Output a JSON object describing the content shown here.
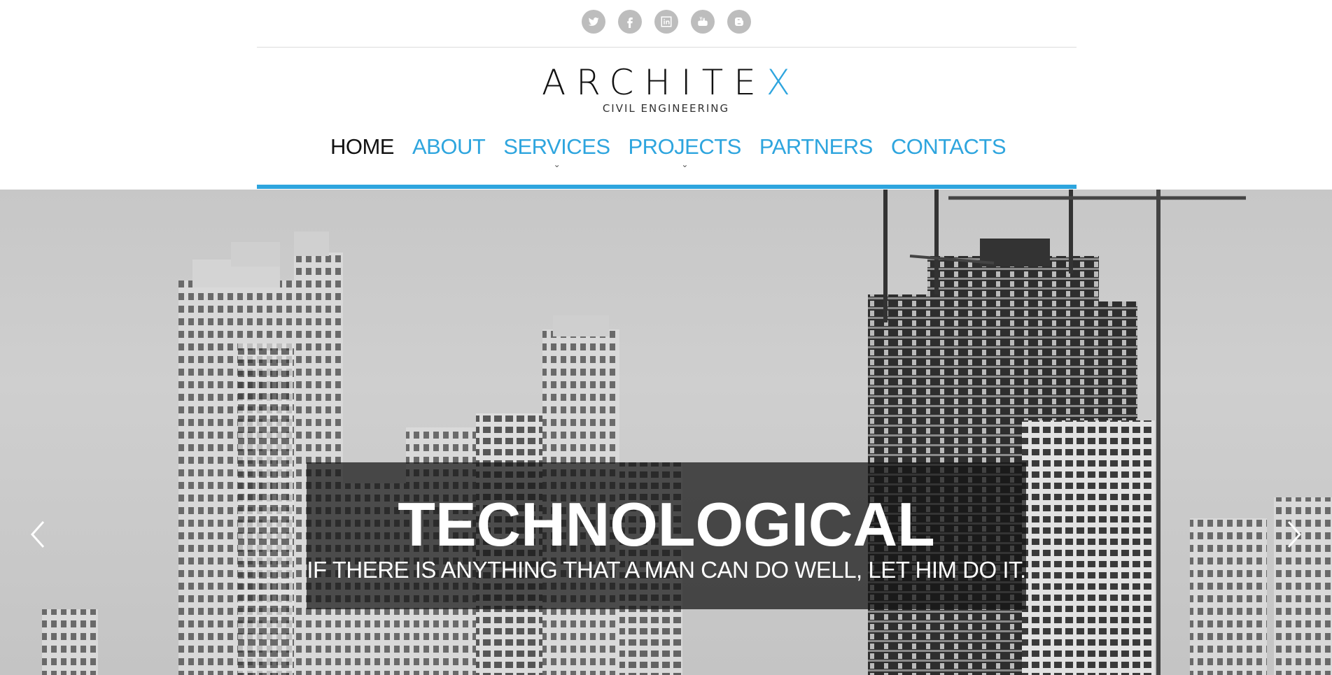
{
  "social": [
    {
      "name": "twitter",
      "icon": "twitter-icon"
    },
    {
      "name": "facebook",
      "icon": "facebook-icon"
    },
    {
      "name": "linkedin",
      "icon": "linkedin-icon"
    },
    {
      "name": "youtube",
      "icon": "youtube-icon"
    },
    {
      "name": "blogger",
      "icon": "blogger-icon"
    }
  ],
  "logo": {
    "title_main": "ARCHITE",
    "title_accent": "X",
    "subtitle": "CIVIL ENGINEERING"
  },
  "nav": {
    "items": [
      {
        "label": "HOME",
        "active": true,
        "has_submenu": false
      },
      {
        "label": "ABOUT",
        "active": false,
        "has_submenu": false
      },
      {
        "label": "SERVICES",
        "active": false,
        "has_submenu": true
      },
      {
        "label": "PROJECTS",
        "active": false,
        "has_submenu": true
      },
      {
        "label": "PARTNERS",
        "active": false,
        "has_submenu": false
      },
      {
        "label": "CONTACTS",
        "active": false,
        "has_submenu": false
      }
    ],
    "submenu_caret": "⌄"
  },
  "hero": {
    "title": "TECHNOLOGICAL",
    "subtitle": "IF THERE IS ANYTHING THAT A MAN CAN DO WELL, LET HIM DO IT.",
    "prev_icon": "chevron-left-icon",
    "next_icon": "chevron-right-icon"
  },
  "colors": {
    "accent": "#2ea5de",
    "text_dark": "#111111",
    "social_grey": "#bdbdbd"
  }
}
